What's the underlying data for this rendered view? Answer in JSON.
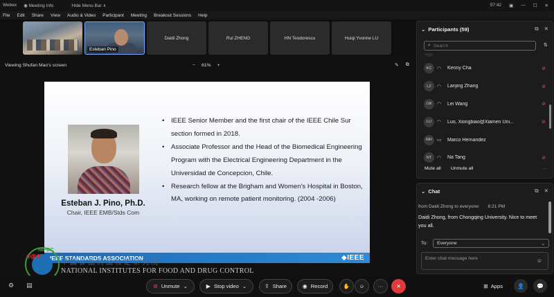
{
  "titlebar": {
    "app": "Webex",
    "meeting_info": "Meeting Info",
    "hide_menu": "Hide Menu Bar",
    "hide_menu_caret": "∧",
    "clock": "57:42"
  },
  "menu": [
    "File",
    "Edit",
    "Share",
    "View",
    "Audio & Video",
    "Participant",
    "Meeting",
    "Breakout Sessions",
    "Help"
  ],
  "video_tiles": [
    {
      "name": ""
    },
    {
      "name": "Esteban Pino"
    },
    {
      "name": "Daidi Zhong"
    },
    {
      "name": "Rui ZHENG"
    },
    {
      "name": "HN Teodorescu"
    },
    {
      "name": "Huiqi Yvonne LU"
    }
  ],
  "share_bar": {
    "viewing": "Viewing Shufan Mao's screen",
    "zoom_out": "−",
    "zoom": "61%",
    "zoom_in": "+"
  },
  "slide": {
    "name": "Esteban J. Pino, Ph.D.",
    "subtitle": "Chair, IEEE EMB/Stds Com",
    "bullets": [
      "IEEE Senior Member and the first chair of the IEEE Chile Sur section formed in 2018.",
      "Associate Professor and the Head of the Biomedical Engineering Program with the Electrical Engineering Department in the Universidad de Concepcion, Chile.",
      "Research fellow at the Brigham and Women's Hospital in Boston, MA, working on remote patient monitoring. (2004 -2006)"
    ],
    "footer_left": "IEEE STANDARDS ASSOCIATION",
    "footer_right": "◆IEEE"
  },
  "watermark": {
    "logo_top": "NIFDC",
    "logo_cn": "中国食",
    "cn_text": "中国食品药品检定研究院",
    "en_text": "NATIONAL INSTITUTES FOR FOOD AND DRUG CONTROL"
  },
  "participants_panel": {
    "title": "Participants (59)",
    "search_placeholder": "Search",
    "items": [
      {
        "initials": "KC",
        "name": "Kenny Cha"
      },
      {
        "initials": "LZ",
        "name": "Lanjing Zhang"
      },
      {
        "initials": "LW",
        "name": "Lei Wang"
      },
      {
        "initials": "LU",
        "name": "Luo, Xiongbiao@Xiamen Uni..."
      },
      {
        "initials": "MH",
        "name": "Marco Hernandez"
      },
      {
        "initials": "NT",
        "name": "Na Tang"
      }
    ],
    "mute_all": "Mute all",
    "unmute_all": "Unmute all",
    "more": "···"
  },
  "chat_panel": {
    "title": "Chat",
    "from": "from Daidi Zhong to everyone:",
    "time": "8:21 PM",
    "message": "Daidi Zhong,  from Chongqing University. Nice to meet you all.",
    "to_label": "To:",
    "to_value": "Everyone",
    "input_placeholder": "Enter chat message here"
  },
  "controls": {
    "unmute": "Unmute",
    "stop_video": "Stop video",
    "share": "Share",
    "record": "Record",
    "more": "···",
    "apps": "Apps"
  },
  "colors": {
    "accent": "#7aa7ff",
    "mute_red": "#e35353",
    "leave_red": "#e03a3a",
    "ieee_blue": "#1b6cb8"
  }
}
